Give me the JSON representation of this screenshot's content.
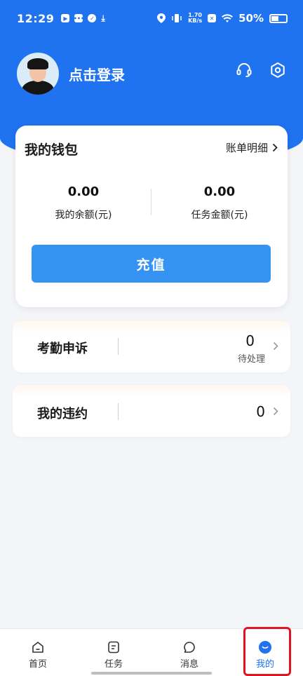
{
  "status_bar": {
    "time": "12:29",
    "speed_top": "1.70",
    "speed_bottom": "KB/s",
    "battery": "50%"
  },
  "profile": {
    "login_label": "点击登录"
  },
  "wallet": {
    "title": "我的钱包",
    "bill_link": "账单明细",
    "balance_value": "0.00",
    "balance_label": "我的余额(元)",
    "task_value": "0.00",
    "task_label": "任务金额(元)",
    "recharge_label": "充值"
  },
  "attendance": {
    "title": "考勤申诉",
    "count": "0",
    "sub": "待处理"
  },
  "violation": {
    "title": "我的违约",
    "count": "0"
  },
  "nav": {
    "items": [
      {
        "label": "首页",
        "icon": "home-icon"
      },
      {
        "label": "任务",
        "icon": "task-icon"
      },
      {
        "label": "消息",
        "icon": "message-icon"
      },
      {
        "label": "我的",
        "icon": "profile-icon"
      }
    ],
    "active_color": "#1f73f1"
  },
  "colors": {
    "brand_blue": "#1f73f1",
    "button_blue": "#3493f3",
    "highlight_red": "#e0141e"
  }
}
